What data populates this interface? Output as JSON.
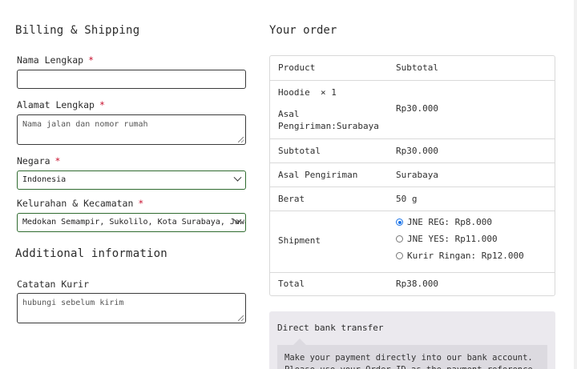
{
  "billing": {
    "title": "Billing & Shipping",
    "full_name": {
      "label": "Nama Lengkap",
      "required_mark": "*",
      "value": ""
    },
    "address": {
      "label": "Alamat Lengkap",
      "required_mark": "*",
      "placeholder": "Nama jalan dan nomor rumah"
    },
    "country": {
      "label": "Negara",
      "required_mark": "*",
      "selected": "Indonesia"
    },
    "district": {
      "label": "Kelurahan & Kecamatan",
      "required_mark": "*",
      "selected": "Medokan Semampir, Sukolilo, Kota Surabaya, Jawa Timur"
    }
  },
  "additional": {
    "title": "Additional information",
    "courier_note": {
      "label": "Catatan Kurir",
      "placeholder": "hubungi sebelum kirim"
    }
  },
  "order": {
    "title": "Your order",
    "headers": {
      "product": "Product",
      "subtotal": "Subtotal"
    },
    "item": {
      "name": "Hoodie",
      "qty": "× 1",
      "origin_label": "Asal Pengiriman:",
      "origin_value": "Surabaya",
      "price": "Rp30.000"
    },
    "subtotal": {
      "label": "Subtotal",
      "value": "Rp30.000"
    },
    "origin": {
      "label": "Asal Pengiriman",
      "value": "Surabaya"
    },
    "weight": {
      "label": "Berat",
      "value": "50 g"
    },
    "shipment": {
      "label": "Shipment",
      "options": [
        {
          "label": "JNE REG: Rp8.000",
          "checked": true
        },
        {
          "label": "JNE YES: Rp11.000",
          "checked": false
        },
        {
          "label": "Kurir Ringan: Rp12.000",
          "checked": false
        }
      ]
    },
    "total": {
      "label": "Total",
      "value": "Rp38.000"
    }
  },
  "payment": {
    "method": "Direct bank transfer",
    "description": "Make your payment directly into our bank account. Please use your Order ID as the payment reference."
  },
  "colors": {
    "required": "#c8102e",
    "radio_checked": "#1a73e8",
    "select_border": "#2f6b2f",
    "payment_bg": "#ebe9ee"
  }
}
